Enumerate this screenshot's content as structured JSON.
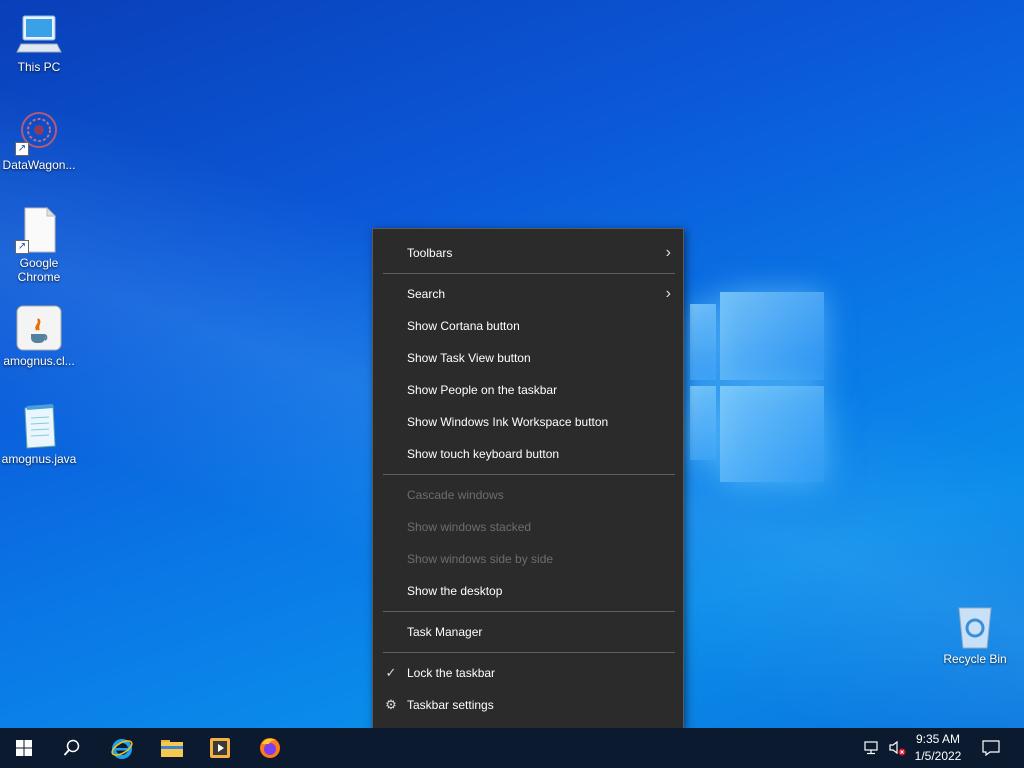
{
  "desktop": {
    "icons": [
      {
        "label": "This PC"
      },
      {
        "label": "DataWagon..."
      },
      {
        "label": "Google Chrome"
      },
      {
        "label": "amognus.cl..."
      },
      {
        "label": "amognus.java"
      },
      {
        "label": "Recycle Bin"
      }
    ]
  },
  "context_menu": {
    "items": [
      {
        "label": "Toolbars",
        "submenu": true
      },
      {
        "label": "Search",
        "submenu": true
      },
      {
        "label": "Show Cortana button"
      },
      {
        "label": "Show Task View button"
      },
      {
        "label": "Show People on the taskbar"
      },
      {
        "label": "Show Windows Ink Workspace button"
      },
      {
        "label": "Show touch keyboard button"
      },
      {
        "label": "Cascade windows",
        "disabled": true
      },
      {
        "label": "Show windows stacked",
        "disabled": true
      },
      {
        "label": "Show windows side by side",
        "disabled": true
      },
      {
        "label": "Show the desktop"
      },
      {
        "label": "Task Manager"
      },
      {
        "label": "Lock the taskbar",
        "checked": true
      },
      {
        "label": "Taskbar settings",
        "icon": "gear-icon"
      }
    ]
  },
  "taskbar": {
    "pinned": [
      "start-icon",
      "search-icon",
      "internet-explorer-icon",
      "file-explorer-icon",
      "media-player-icon",
      "firefox-icon"
    ],
    "tray": {
      "time": "9:35 AM",
      "date": "1/5/2022"
    }
  },
  "colors": {
    "menu_bg": "#2b2b2b",
    "taskbar_bg": "#0b1a2e",
    "disabled_text": "#6d6d6d"
  }
}
